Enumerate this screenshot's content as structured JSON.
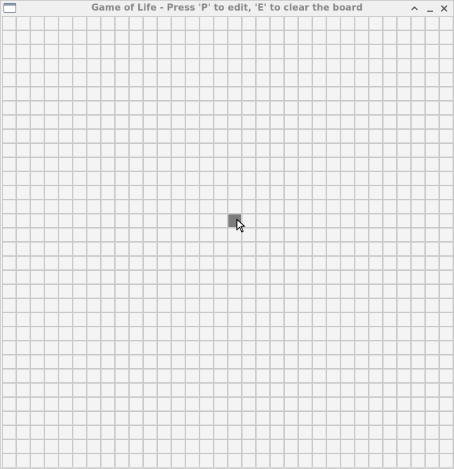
{
  "window": {
    "title": "Game of Life - Press 'P' to edit, 'E' to clear the board",
    "controls": [
      "maximize-icon",
      "minimize-icon",
      "close-icon"
    ]
  },
  "board": {
    "rows": 32,
    "cols": 32,
    "cell_color_dead": "#f4f4f4",
    "cell_color_alive": "#7d7d7d",
    "grid_line_color": "#c9c9c9",
    "alive_cells": [
      [
        14,
        16
      ]
    ]
  },
  "cursor": {
    "icon": "pointer-arrow-icon"
  }
}
